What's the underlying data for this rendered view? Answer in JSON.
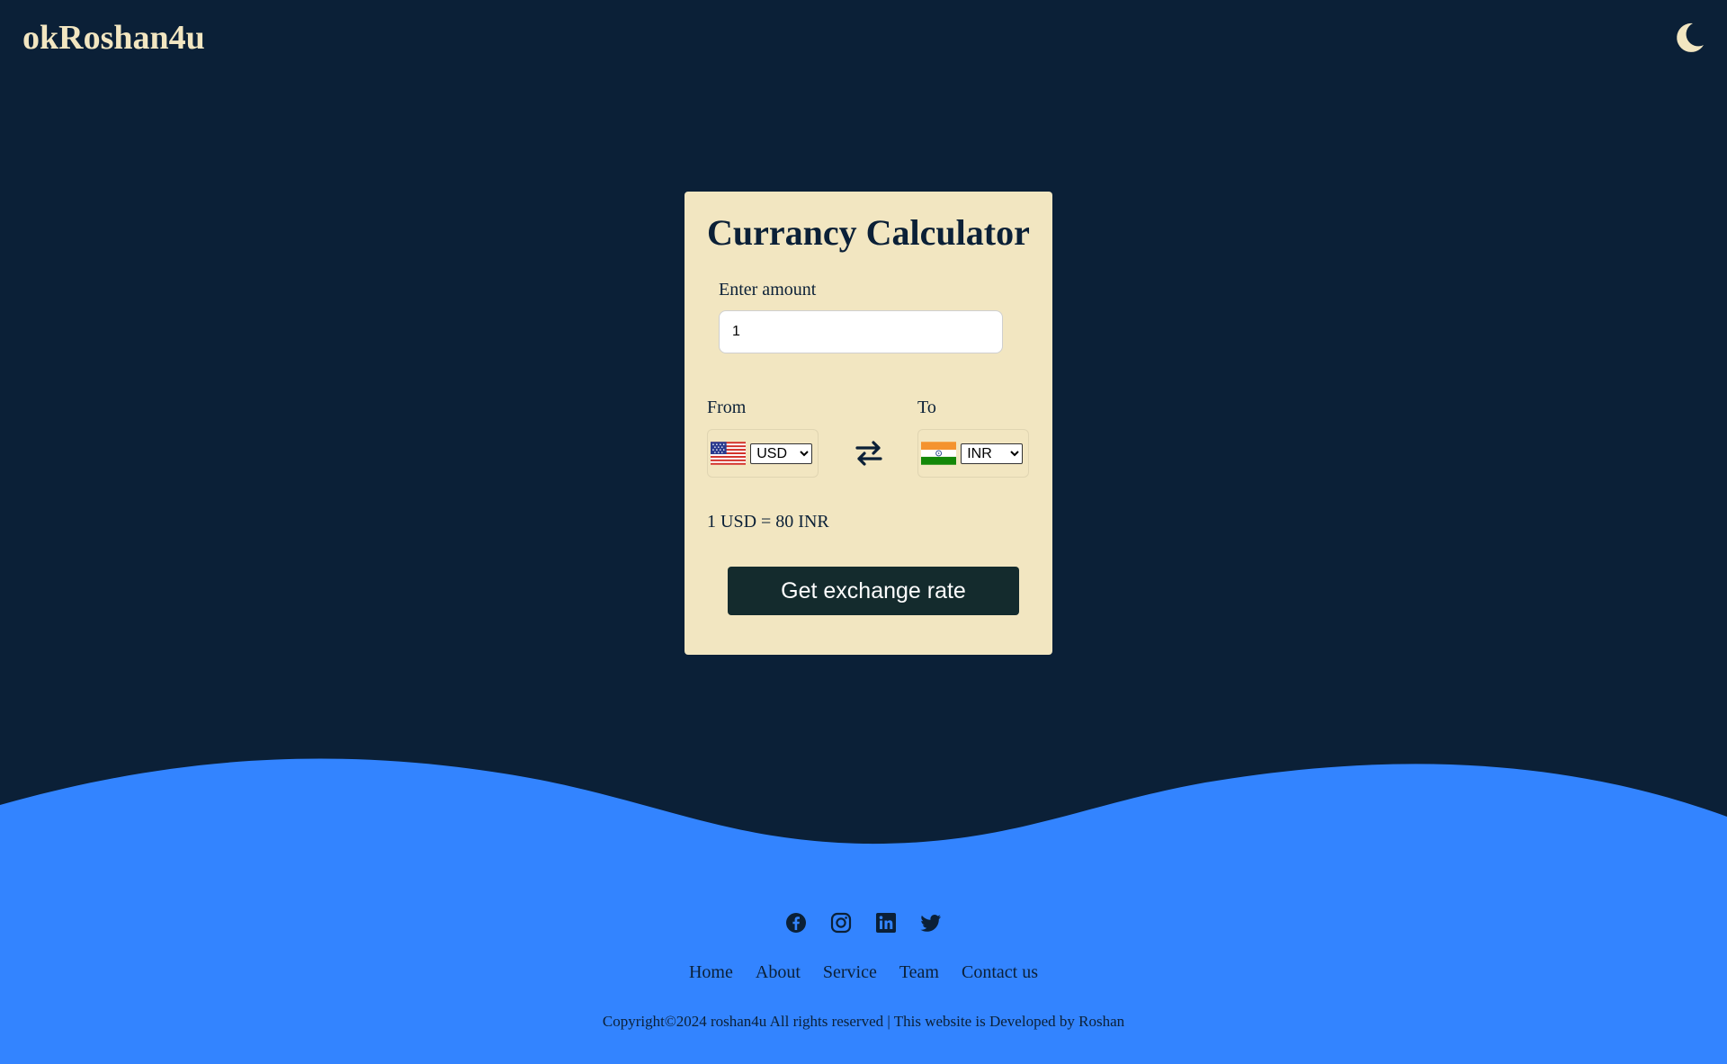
{
  "header": {
    "brand": "okRoshan4u",
    "theme_toggle_icon": "moon-icon"
  },
  "calculator": {
    "title": "Currancy Calculator",
    "amount_label": "Enter amount",
    "amount_value": "1",
    "from_label": "From",
    "to_label": "To",
    "from_currency": "USD",
    "to_currency": "INR",
    "from_flag_icon": "us-flag-icon",
    "to_flag_icon": "india-flag-icon",
    "swap_icon": "swap-arrows-icon",
    "rate_text": "1 USD = 80 INR",
    "button_label": "Get exchange rate"
  },
  "footer": {
    "social": [
      "facebook-icon",
      "instagram-icon",
      "linkedin-icon",
      "twitter-icon"
    ],
    "links": [
      "Home",
      "About",
      "Service",
      "Team",
      "Contact us"
    ],
    "copyright": "Copyright©2024 roshan4u All rights reserved | This website is Developed by Roshan"
  },
  "colors": {
    "background": "#0b2037",
    "card": "#f2e6c1",
    "accent_wave": "#3384ff",
    "button": "#142b2d"
  }
}
